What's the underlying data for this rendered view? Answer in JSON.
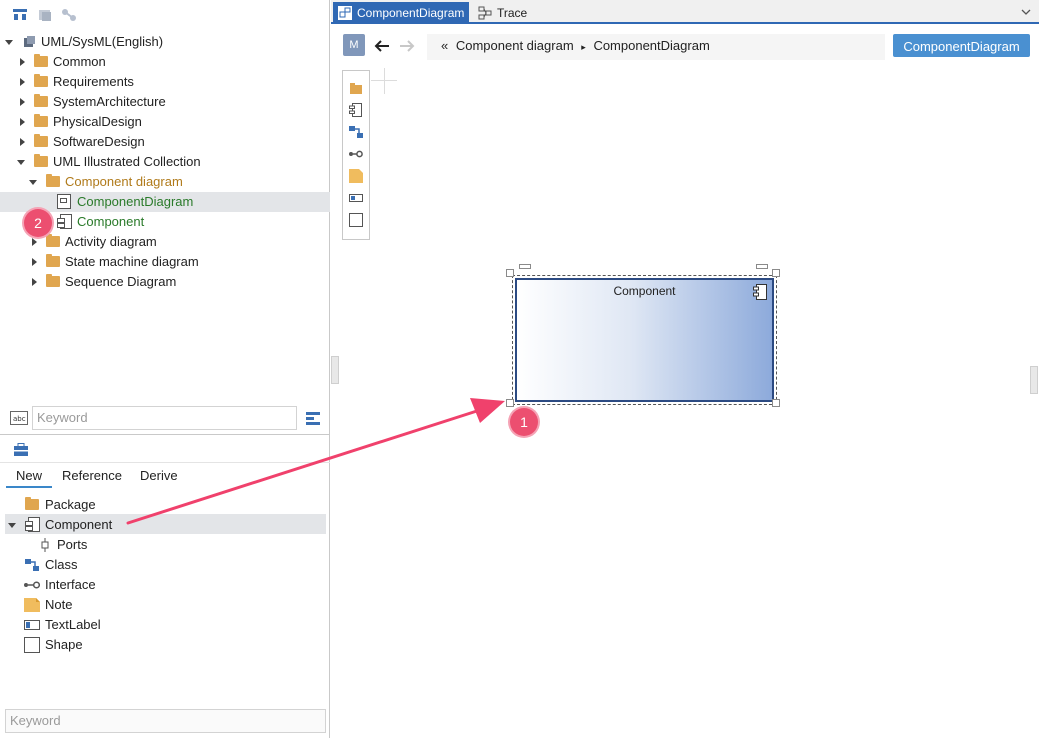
{
  "left_panel": {
    "tree": {
      "root": "UML/SysML(English)",
      "items": [
        {
          "label": "Common"
        },
        {
          "label": "Requirements"
        },
        {
          "label": "SystemArchitecture"
        },
        {
          "label": "PhysicalDesign"
        },
        {
          "label": "SoftwareDesign"
        },
        {
          "label": "UML Illustrated Collection"
        },
        {
          "label": "Component diagram"
        },
        {
          "label": "ComponentDiagram"
        },
        {
          "label": "Component"
        },
        {
          "label": "Activity diagram"
        },
        {
          "label": "State machine diagram"
        },
        {
          "label": "Sequence Diagram"
        }
      ]
    },
    "search": {
      "placeholder": "Keyword"
    },
    "toolbox": {
      "tabs": [
        {
          "label": "New"
        },
        {
          "label": "Reference"
        },
        {
          "label": "Derive"
        }
      ],
      "items": [
        {
          "label": "Package"
        },
        {
          "label": "Component"
        },
        {
          "label": "Ports"
        },
        {
          "label": "Class"
        },
        {
          "label": "Interface"
        },
        {
          "label": "Note"
        },
        {
          "label": "TextLabel"
        },
        {
          "label": "Shape"
        }
      ],
      "search_placeholder": "Keyword"
    },
    "colors": {
      "folder": "#e0a64f",
      "selected_text": "#2a7a2a",
      "highlight_text": "#b07a1a"
    }
  },
  "editor": {
    "tabs": [
      {
        "label": "ComponentDiagram"
      },
      {
        "label": "Trace"
      }
    ],
    "mode_button": "M",
    "breadcrumb": {
      "prefix": "«",
      "parent": "Component diagram",
      "separator": "▸",
      "current": "ComponentDiagram"
    },
    "primary_button": "ComponentDiagram",
    "canvas": {
      "component_name": "Component"
    },
    "colors": {
      "tab_active": "#2f68b4",
      "primary_button": "#4a90d1",
      "component_border": "#2c4a82"
    }
  },
  "annotations": {
    "badge_1": "1",
    "badge_2": "2",
    "arrow_color": "#f0416c"
  }
}
